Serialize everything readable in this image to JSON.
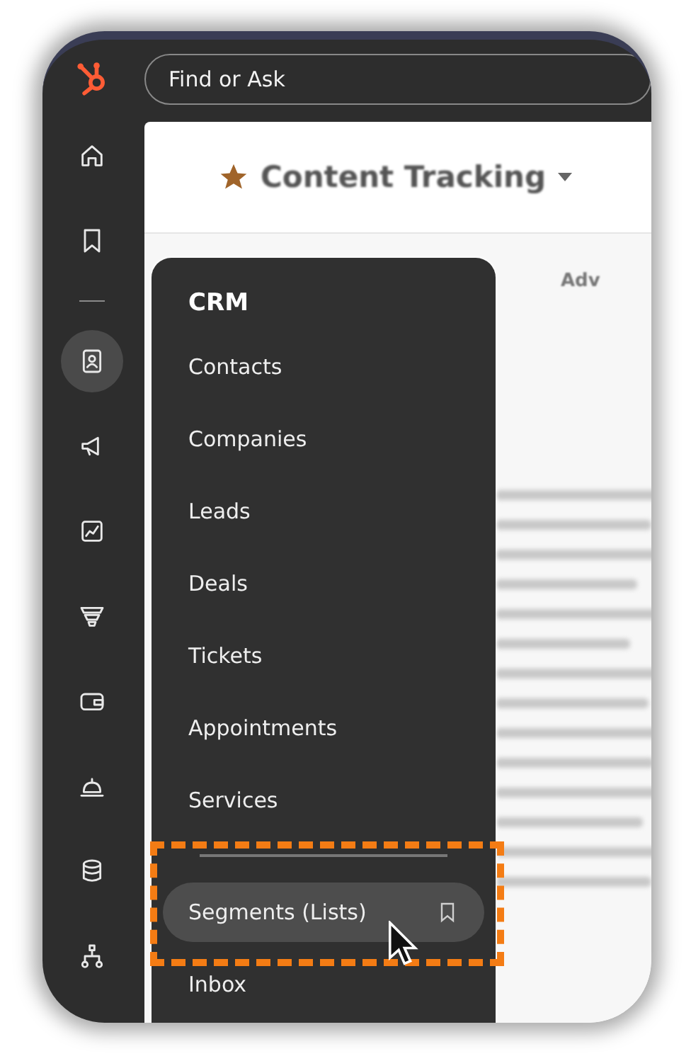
{
  "search": {
    "placeholder": "Find or Ask"
  },
  "sidebar": {
    "items": [
      {
        "kind": "home",
        "selected": false
      },
      {
        "kind": "bookmark",
        "selected": false
      },
      {
        "kind": "contacts",
        "selected": true
      },
      {
        "kind": "megaphone",
        "selected": false
      },
      {
        "kind": "report",
        "selected": false
      },
      {
        "kind": "funnel",
        "selected": false
      },
      {
        "kind": "wallet",
        "selected": false
      },
      {
        "kind": "bell",
        "selected": false
      },
      {
        "kind": "database",
        "selected": false
      },
      {
        "kind": "network",
        "selected": false
      }
    ]
  },
  "page": {
    "title": "Content Tracking",
    "toolbar_button": "Adv"
  },
  "menu": {
    "title": "CRM",
    "items": [
      {
        "label": "Contacts",
        "selected": false,
        "bookmark": false
      },
      {
        "label": "Companies",
        "selected": false,
        "bookmark": false
      },
      {
        "label": "Leads",
        "selected": false,
        "bookmark": false
      },
      {
        "label": "Deals",
        "selected": false,
        "bookmark": false
      },
      {
        "label": "Tickets",
        "selected": false,
        "bookmark": false
      },
      {
        "label": "Appointments",
        "selected": false,
        "bookmark": false
      },
      {
        "label": "Services",
        "selected": false,
        "bookmark": false
      },
      {
        "label": "Segments (Lists)",
        "selected": true,
        "bookmark": true,
        "divider_before": true
      },
      {
        "label": "Inbox",
        "selected": false,
        "bookmark": false
      }
    ]
  }
}
